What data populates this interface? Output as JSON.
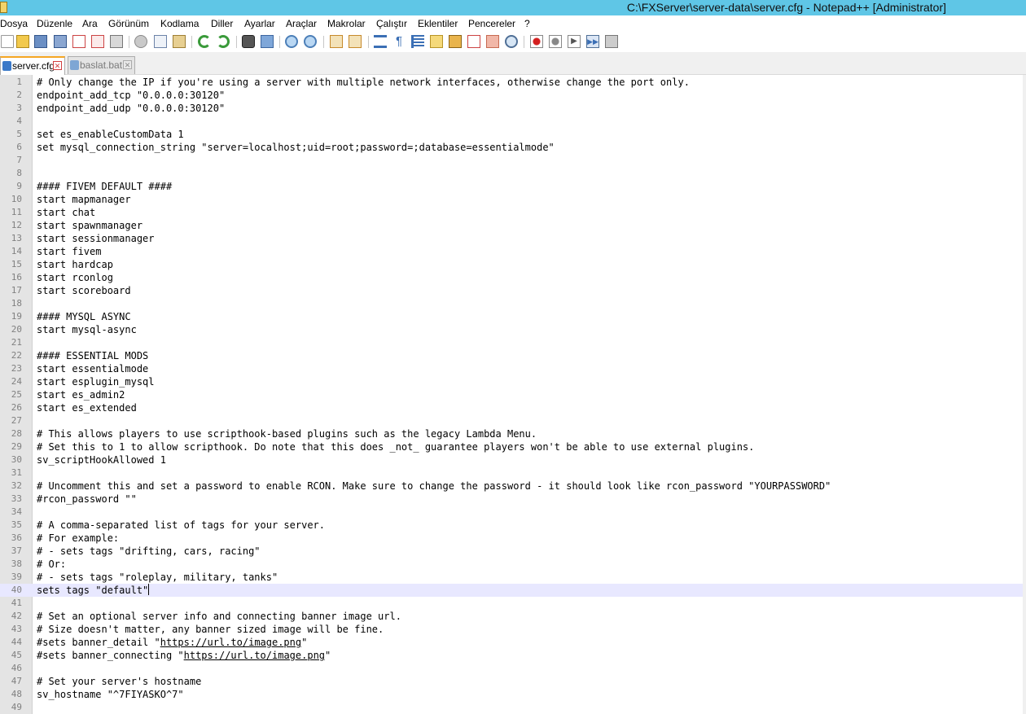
{
  "window": {
    "title": "C:\\FXServer\\server-data\\server.cfg - Notepad++ [Administrator]"
  },
  "menu": [
    "Dosya",
    "Düzenle",
    "Ara",
    "Görünüm",
    "Kodlama",
    "Diller",
    "Ayarlar",
    "Araçlar",
    "Makrolar",
    "Çalıştır",
    "Eklentiler",
    "Pencereler",
    "?"
  ],
  "toolbar": {
    "icons": [
      "new-file-icon",
      "open-file-icon",
      "save-icon",
      "save-all-icon",
      "close-icon",
      "close-all-icon",
      "print-icon",
      "cut-icon",
      "copy-icon",
      "paste-icon",
      "undo-icon",
      "redo-icon",
      "find-icon",
      "replace-icon",
      "zoom-in-icon",
      "zoom-out-icon",
      "sync-vertical-icon",
      "sync-horizontal-icon",
      "word-wrap-icon",
      "show-all-characters-icon",
      "indent-guide-icon",
      "user-defined-language-icon",
      "document-map-icon",
      "function-list-icon",
      "folder-as-workspace-icon",
      "monitoring-icon",
      "record-macro-icon",
      "stop-macro-icon",
      "play-macro-icon",
      "run-macro-multiple-icon",
      "save-macro-icon"
    ]
  },
  "tabs": [
    {
      "label": "server.cfg",
      "active": true,
      "icon_color": "#3b79c8"
    },
    {
      "label": "baslat.bat",
      "active": false,
      "icon_color": "#7ea6d4"
    }
  ],
  "editor": {
    "current_line": 40,
    "lines": [
      "# Only change the IP if you're using a server with multiple network interfaces, otherwise change the port only.",
      "endpoint_add_tcp \"0.0.0.0:30120\"",
      "endpoint_add_udp \"0.0.0.0:30120\"",
      "",
      "set es_enableCustomData 1",
      "set mysql_connection_string \"server=localhost;uid=root;password=;database=essentialmode\"",
      "",
      "",
      "#### FIVEM DEFAULT ####",
      "start mapmanager",
      "start chat",
      "start spawnmanager",
      "start sessionmanager",
      "start fivem",
      "start hardcap",
      "start rconlog",
      "start scoreboard",
      "",
      "#### MYSQL ASYNC",
      "start mysql-async",
      "",
      "#### ESSENTIAL MODS",
      "start essentialmode",
      "start esplugin_mysql",
      "start es_admin2",
      "start es_extended",
      "",
      "# This allows players to use scripthook-based plugins such as the legacy Lambda Menu.",
      "# Set this to 1 to allow scripthook. Do note that this does _not_ guarantee players won't be able to use external plugins.",
      "sv_scriptHookAllowed 1",
      "",
      "# Uncomment this and set a password to enable RCON. Make sure to change the password - it should look like rcon_password \"YOURPASSWORD\"",
      "#rcon_password \"\"",
      "",
      "# A comma-separated list of tags for your server.",
      "# For example:",
      "# - sets tags \"drifting, cars, racing\"",
      "# Or:",
      "# - sets tags \"roleplay, military, tanks\"",
      "sets tags \"default\"",
      "",
      "# Set an optional server info and connecting banner image url.",
      "# Size doesn't matter, any banner sized image will be fine.",
      "#sets banner_detail \"https://url.to/image.png\"",
      "#sets banner_connecting \"https://url.to/image.png\"",
      "",
      "# Set your server's hostname",
      "sv_hostname \"^7FIYASKO^7\"",
      ""
    ]
  },
  "colors": {
    "titlebar": "#5fc6e6",
    "active_tab_accent": "#f5a623",
    "current_line_bg": "#e8e8ff",
    "gutter_bg": "#e4e4e4",
    "line_number": "#808080"
  }
}
